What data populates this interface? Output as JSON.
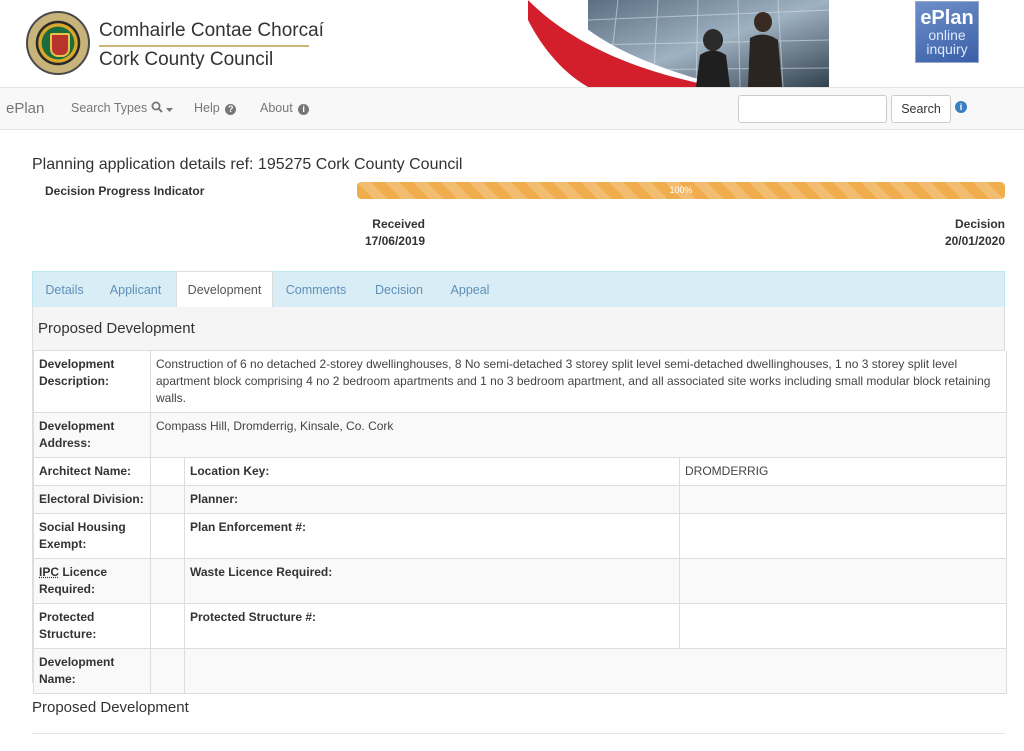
{
  "banner": {
    "council_irish": "Comhairle Contae Chorcaí",
    "council_english": "Cork County Council",
    "logo_line1": "ePlan",
    "logo_line2": "online",
    "logo_line3": "inquiry"
  },
  "navbar": {
    "brand": "ePlan",
    "search_types": "Search Types",
    "help": "Help",
    "about": "About",
    "search_placeholder": "",
    "search_button": "Search"
  },
  "page": {
    "title": "Planning application details ref: 195275 Cork County Council",
    "progress_label": "Decision Progress Indicator",
    "progress_percent_text": "100%",
    "progress_value": 1.0,
    "received_label": "Received",
    "received_date": "17/06/2019",
    "decision_label": "Decision",
    "decision_date": "20/01/2020"
  },
  "tabs": [
    "Details",
    "Applicant",
    "Development",
    "Comments",
    "Decision",
    "Appeal"
  ],
  "active_tab": "Development",
  "panel": {
    "heading": "Proposed Development",
    "dev_desc_label": "Development Description:",
    "dev_desc_value": "Construction of 6 no detached 2-storey dwellinghouses, 8 No semi-detached 3 storey split level semi-detached dwellinghouses, 1 no 3 storey split level apartment block comprising 4 no 2 bedroom apartments and 1 no 3 bedroom apartment, and all associated site works including small modular block retaining walls.",
    "dev_addr_label": "Development Address:",
    "dev_addr_value": "Compass Hill, Dromderrig, Kinsale, Co. Cork",
    "architect_label": "Architect Name:",
    "architect_value": "",
    "location_key_label": "Location Key:",
    "location_key_value": "DROMDERRIG",
    "electoral_label": "Electoral Division:",
    "electoral_value": "",
    "planner_label": "Planner:",
    "planner_value": "",
    "social_label": "Social Housing Exempt:",
    "social_value": "",
    "plan_enf_label": "Plan Enforcement #:",
    "plan_enf_value": "",
    "ipc_abbr": "IPC",
    "ipc_label_rest": " Licence Required:",
    "ipc_value": "",
    "waste_label": "Waste Licence Required:",
    "waste_value": "",
    "protected_label": "Protected Structure:",
    "protected_value": "",
    "protected_num_label": "Protected Structure #:",
    "protected_num_value": "",
    "dev_name_label": "Development Name:",
    "dev_name_value": ""
  },
  "section2_title": "Proposed Development"
}
